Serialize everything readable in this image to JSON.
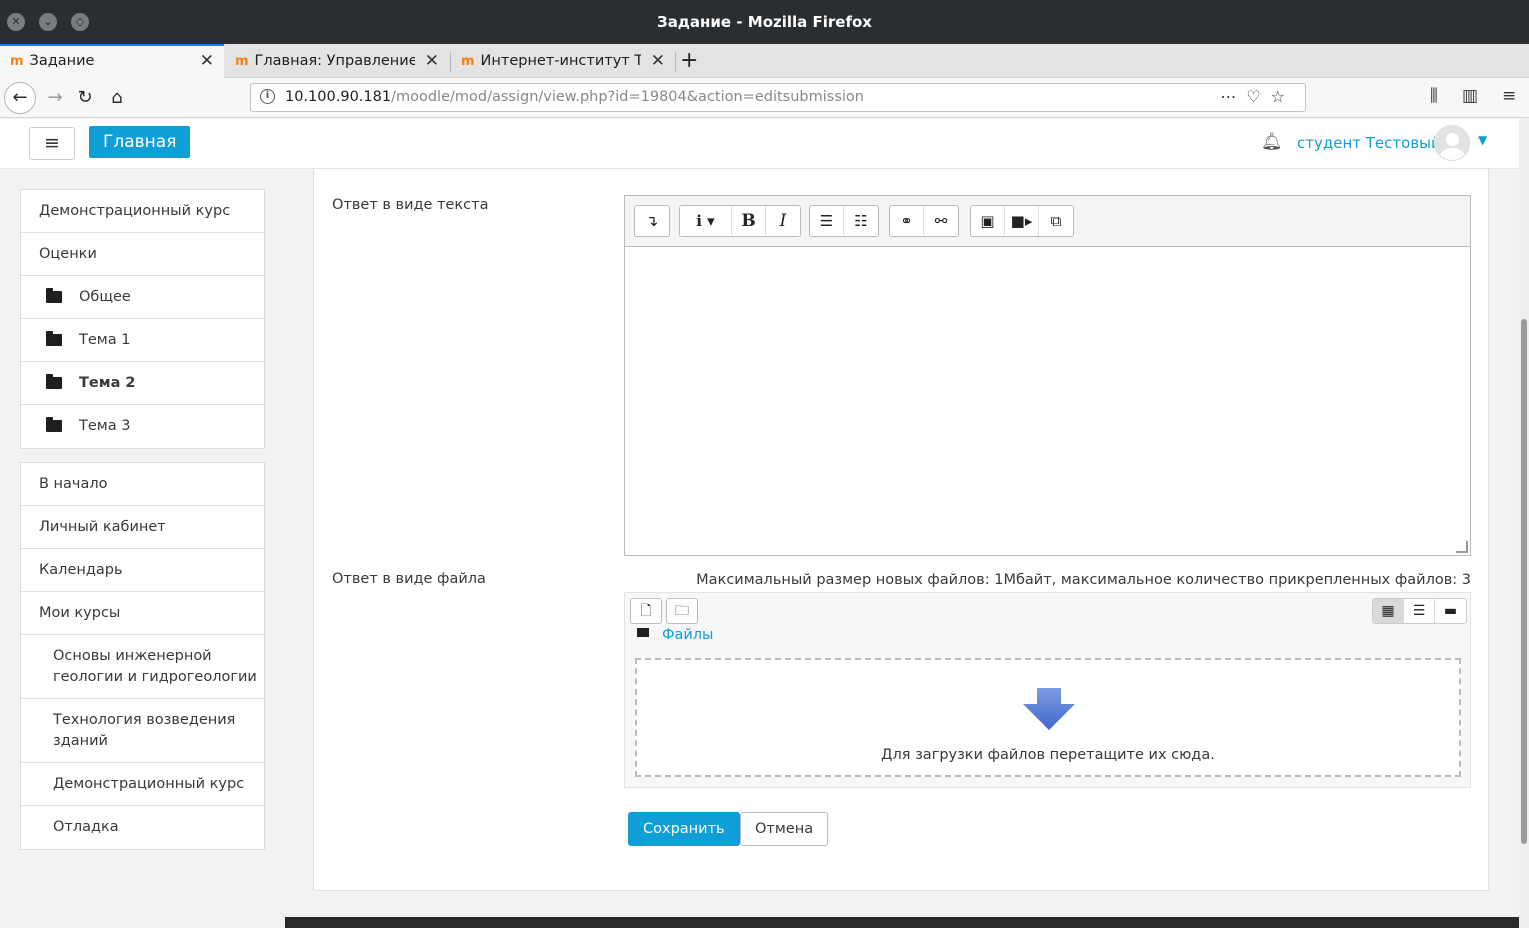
{
  "window": {
    "title": "Задание - Mozilla Firefox"
  },
  "tabs": [
    {
      "label": "Задание",
      "favicon": "moodle-icon",
      "active": true
    },
    {
      "label": "Главная: Управление",
      "favicon": "moodle-icon",
      "active": false
    },
    {
      "label": "Интернет-институт Ту",
      "favicon": "moodle-icon",
      "active": false
    }
  ],
  "url": {
    "host": "10.100.90.181",
    "path": "/moodle/mod/assign/view.php?id=19804&action=editsubmission"
  },
  "header": {
    "home_label": "Главная",
    "user_name": "студент Тестовый"
  },
  "sidebar": {
    "course_block": [
      {
        "label": "Демонстрационный курс"
      },
      {
        "label": "Оценки"
      },
      {
        "label": "Общее",
        "icon": "folder-icon"
      },
      {
        "label": "Тема 1",
        "icon": "folder-icon"
      },
      {
        "label": "Тема 2",
        "icon": "folder-icon",
        "bold": true
      },
      {
        "label": "Тема 3",
        "icon": "folder-icon"
      }
    ],
    "nav_block": [
      {
        "label": "В начало"
      },
      {
        "label": "Личный кабинет"
      },
      {
        "label": "Календарь"
      },
      {
        "label": "Мои курсы"
      },
      {
        "label": "Основы инженерной геологии и гидрогеологии"
      },
      {
        "label": "Технология возведения зданий"
      },
      {
        "label": "Демонстрационный курс"
      },
      {
        "label": "Отладка"
      }
    ]
  },
  "form": {
    "text_label": "Ответ в виде текста",
    "file_label": "Ответ в виде файла",
    "max_info": "Максимальный размер новых файлов: 1Мбайт, максимальное количество прикрепленных файлов: 3",
    "files_path": "Файлы",
    "drop_text": "Для загрузки файлов перетащите их сюда.",
    "save_label": "Сохранить",
    "cancel_label": "Отмена"
  },
  "colors": {
    "accent": "#0f9fd6",
    "titlebar": "#2b2e31"
  }
}
